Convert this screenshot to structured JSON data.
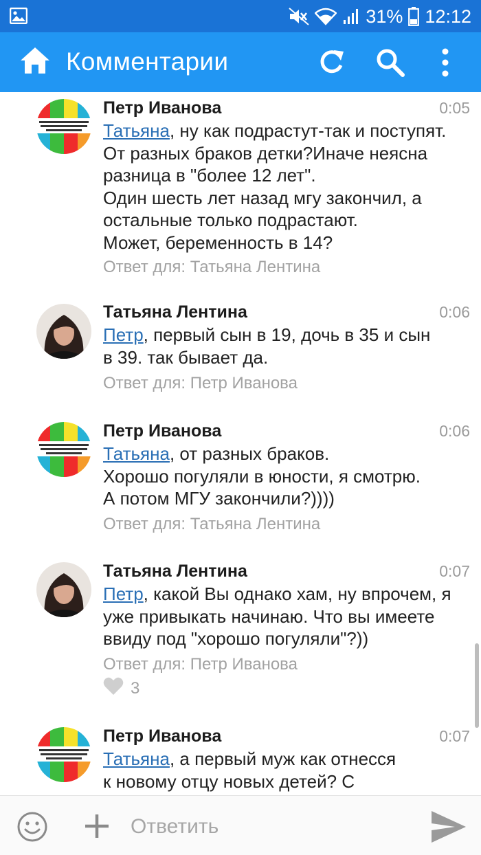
{
  "status_bar": {
    "battery": "31%",
    "time": "12:12"
  },
  "app_bar": {
    "title": "Комментарии"
  },
  "icons": {
    "home": "home-icon",
    "refresh": "refresh-icon",
    "search": "search-icon",
    "more": "more-vert-icon",
    "emoji": "emoji-icon",
    "add": "add-icon",
    "send": "send-icon",
    "like": "heart-icon"
  },
  "comments": [
    {
      "author": "Петр Иванова",
      "time": "0:05",
      "mention": "Татьяна",
      "first_line_rest": ", ну как подрастут-так и поступят.",
      "more_lines": [
        "От разных браков детки?Иначе неясна",
        "разница в \"более 12 лет\".",
        "Один шесть лет назад мгу закончил, а",
        "остальные только подрастают.",
        "Может, беременность в 14?"
      ],
      "reply_to": "Ответ для: Татьяна Лентина"
    },
    {
      "author": "Татьяна Лентина",
      "time": "0:06",
      "mention": "Петр",
      "first_line_rest": ", первый сын в 19, дочь в 35 и сын",
      "more_lines": [
        "в 39. так бывает да."
      ],
      "reply_to": "Ответ для: Петр Иванова"
    },
    {
      "author": "Петр Иванова",
      "time": "0:06",
      "mention": "Татьяна",
      "first_line_rest": ", от разных браков.",
      "more_lines": [
        "Хорошо погуляли в юности, я смотрю.",
        "А потом МГУ закончили?))))"
      ],
      "reply_to": "Ответ для: Татьяна Лентина"
    },
    {
      "author": "Татьяна Лентина",
      "time": "0:07",
      "mention": "Петр",
      "first_line_rest": ", какой Вы однако хам, ну впрочем, я",
      "more_lines": [
        "уже привыкать начинаю. Что вы имеете",
        "ввиду под \"хорошо погуляли\"?))"
      ],
      "reply_to": "Ответ для: Петр Иванова",
      "likes": "3"
    },
    {
      "author": "Петр Иванова",
      "time": "0:07",
      "mention": "Татьяна",
      "first_line_rest": ", а первый муж как отнесся",
      "more_lines": [
        "к новому отцу новых детей? С"
      ]
    }
  ],
  "reply_box": {
    "placeholder": "Ответить"
  },
  "colors": {
    "status_bar": "#1a73d6",
    "app_bar": "#2196f3",
    "mention": "#2a6fb5",
    "muted": "#a2a2a2"
  }
}
